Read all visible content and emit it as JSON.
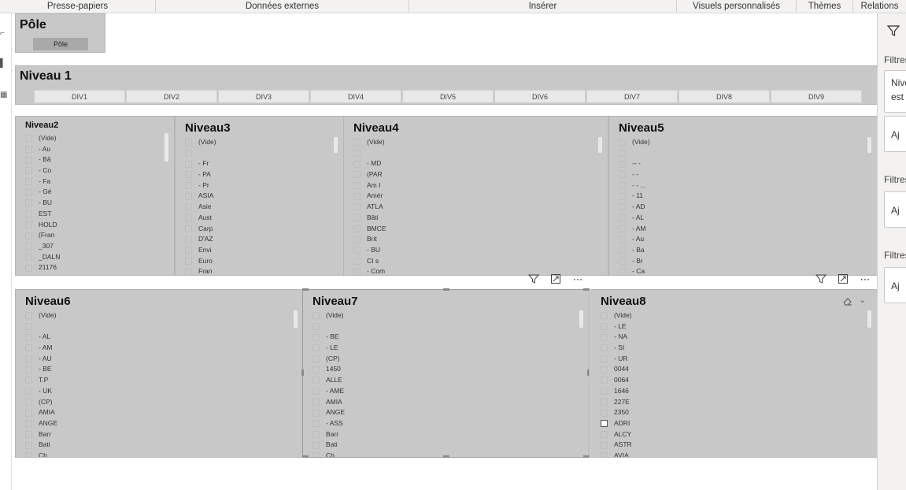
{
  "ribbon": {
    "groups": [
      "Presse-papiers",
      "Données externes",
      "Insérer",
      "Visuels personnalisés",
      "Thèmes",
      "Relations"
    ]
  },
  "filters_pane": {
    "filter_icon": "filter-icon",
    "labels": [
      "Filtres",
      "Filtres",
      "Filtres"
    ],
    "card1_line1": "Nive",
    "card1_line2": "est",
    "add_label": "Aj"
  },
  "pole": {
    "title": "Pôle",
    "button": "Pôle"
  },
  "niveau1": {
    "title": "Niveau 1",
    "tiles": [
      "DIV1",
      "DIV2",
      "DIV3",
      "DIV4",
      "DIV5",
      "DIV6",
      "DIV7",
      "DIV8",
      "DIV9"
    ]
  },
  "niveau2": {
    "title": "Niveau2",
    "items": [
      "(Vide)",
      "- Au",
      "- Bâ",
      "- Co",
      "- Fa",
      "- Gé",
      "- BU",
      "EST",
      "HOLD",
      "(Fran",
      "_307",
      "_DALN",
      "21176"
    ]
  },
  "niveau3": {
    "title": "Niveau3",
    "items": [
      "(Vide)",
      "",
      "- Fr",
      "- PA",
      "- Pr",
      "ASIA",
      "Asie",
      "Aust",
      "Carp",
      "D'AZ",
      "Envi",
      "Euro",
      "Fran"
    ]
  },
  "niveau4": {
    "title": "Niveau4",
    "items": [
      "(Vide)",
      "",
      "- MD",
      "(PAR",
      "Am I",
      "Amér",
      "ATLA",
      "Bâti",
      "BMCE",
      "Brit",
      "- BU",
      "CI s",
      "- Com"
    ]
  },
  "niveau5": {
    "title": "Niveau5",
    "items": [
      "(Vide)",
      "",
      "-- -",
      "- -",
      "- - ...",
      "- 11",
      "- AD",
      "- AL",
      "- AM",
      "- Au",
      "- Ba",
      "- Br",
      "- Ca"
    ]
  },
  "niveau6": {
    "title": "Niveau6",
    "items": [
      "(Vide)",
      "",
      "- AL",
      "- AM",
      "- AU",
      "- BE",
      "T.P",
      "- UK",
      "(CP)",
      "AMIA",
      "ANGE",
      "Barr",
      "Bati",
      "Ch"
    ]
  },
  "niveau7": {
    "title": "Niveau7",
    "items": [
      "(Vide)",
      "",
      "- BE",
      "- LE",
      "(CP)",
      "1450",
      "ALLE",
      "- AME",
      "AMIA",
      "ANGE",
      "- ASS",
      "Barr",
      "Bati",
      "Ch"
    ]
  },
  "niveau8": {
    "title": "Niveau8",
    "items": [
      "(Vide)",
      "- LE",
      "- NA",
      "- SI",
      "- UR",
      "0044",
      "0064",
      "1646",
      "227E",
      "2350",
      "ADRI",
      "ALCY",
      "ASTR",
      "AVIA"
    ]
  },
  "icons": {
    "filter": "filter-icon",
    "focus": "focus-mode-icon",
    "more": "more-options-icon",
    "eraser": "eraser-icon",
    "chevron": "chevron-down-icon"
  }
}
